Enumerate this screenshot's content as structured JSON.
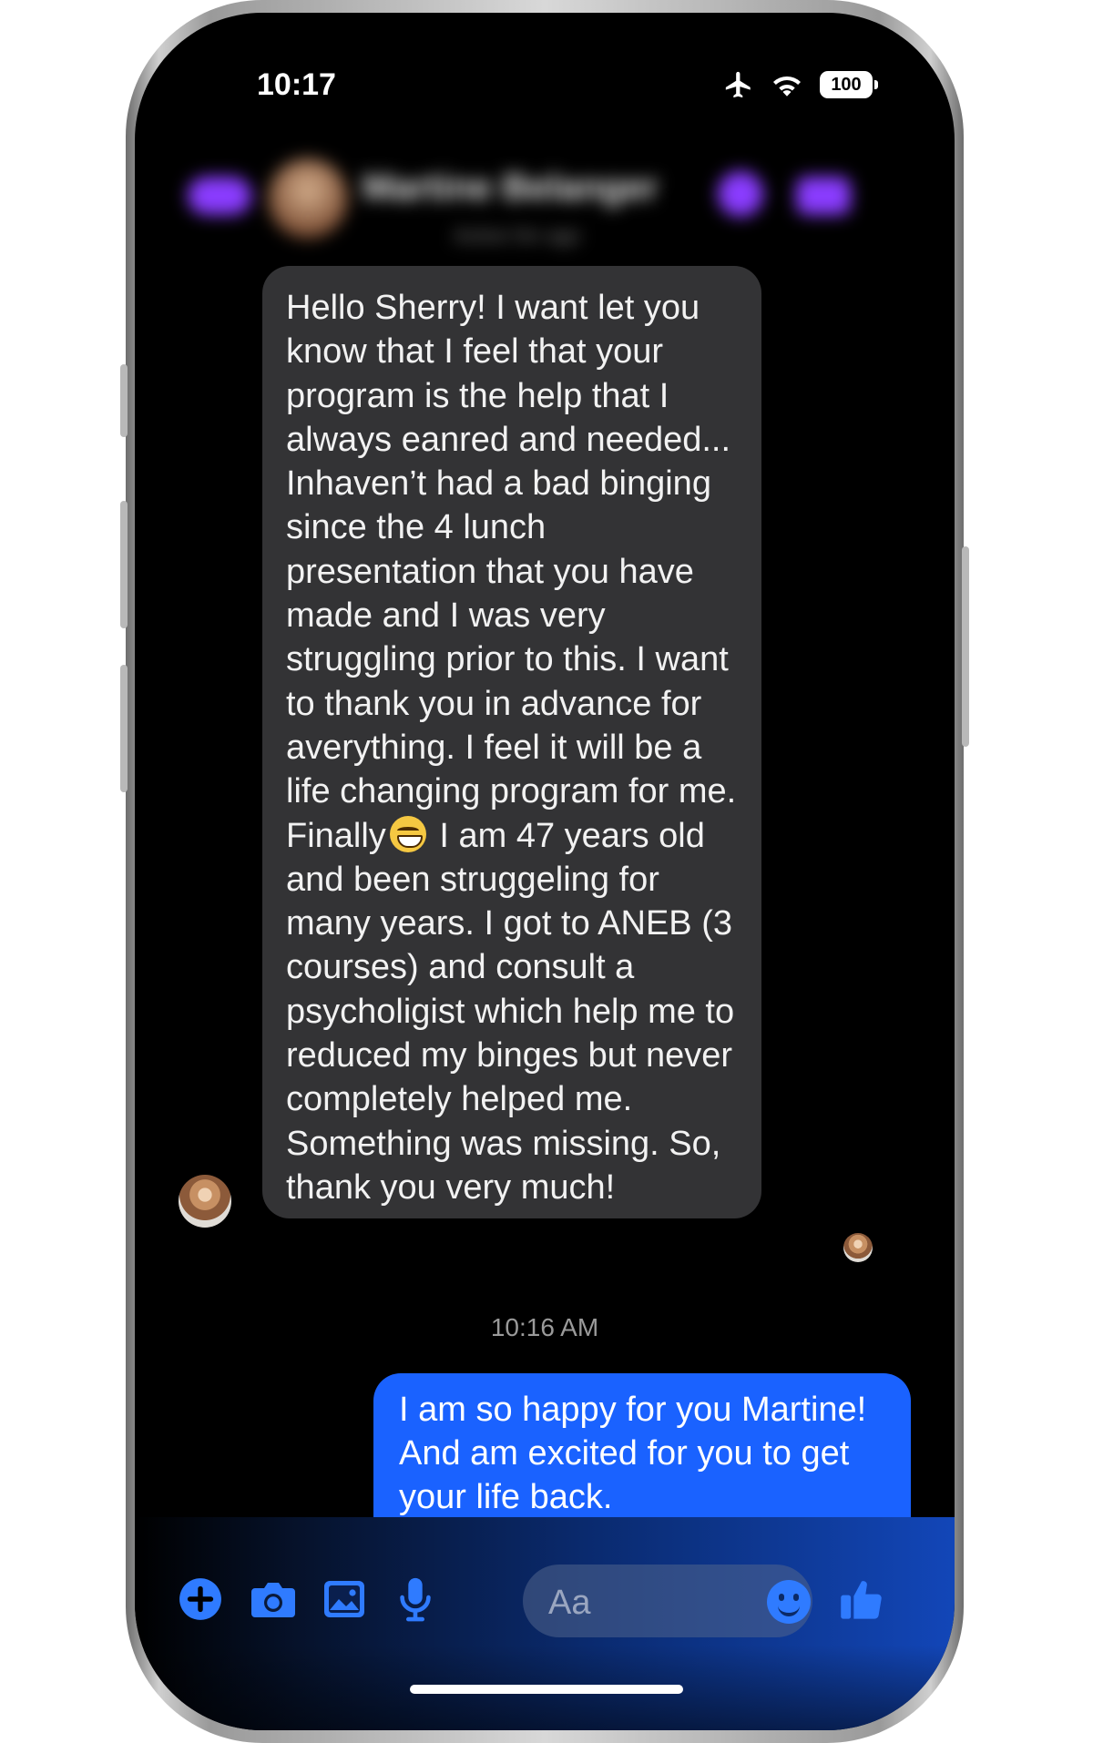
{
  "status_bar": {
    "time": "10:17",
    "battery": "100"
  },
  "header": {
    "contact_name": "Martine Belanger",
    "subtitle": "Active 5m ago"
  },
  "conversation": {
    "incoming_message": "Hello Sherry! I want let you know that I feel that your program is the help that I always eanred and needed... Inhaven’t had a bad binging since the 4 lunch presentation that you have made and I was very struggling prior to this. I want to thank you in advance for averything. I feel it will be a life changing program for me. Finally",
    "incoming_message_after_emoji": " I am 47 years old and been struggeling for many years. I got to ANEB (3 courses) and consult a psycholigist which help me to reduced my binges but never completely helped me. Something was missing. So, thank you very much!",
    "emoji": "grinning-face",
    "timestamp": "10:16 AM",
    "outgoing_message": "I am so happy for you Martine! And am excited for you to get your life back."
  },
  "composer": {
    "placeholder": "Aa",
    "icons": [
      "plus-icon",
      "camera-icon",
      "photo-icon",
      "microphone-icon",
      "emoji-icon",
      "thumbs-up-icon"
    ]
  },
  "colors": {
    "accent_blue": "#1a62ff",
    "incoming_bubble": "#333335",
    "header_accent": "#8a3cff"
  }
}
